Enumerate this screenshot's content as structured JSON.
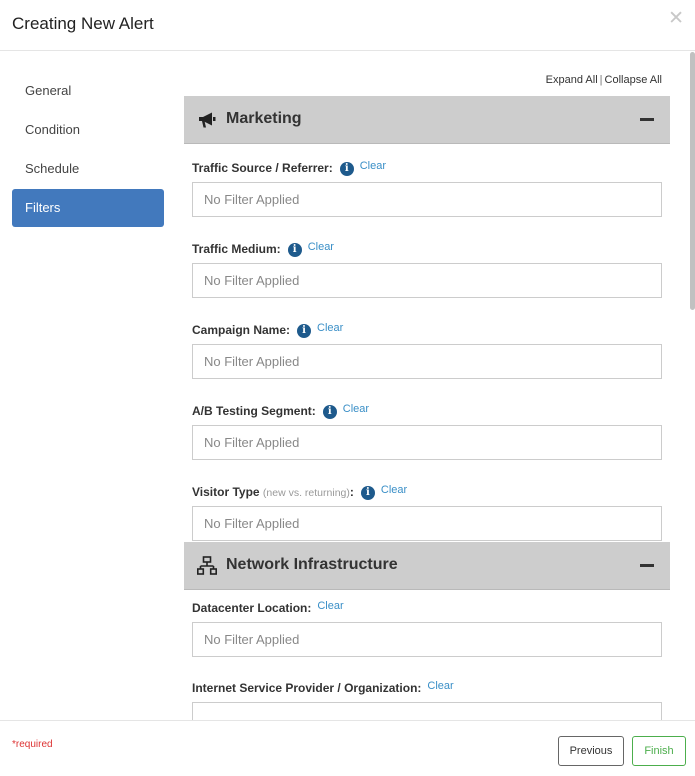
{
  "header": {
    "title": "Creating New Alert",
    "close_glyph": "✕"
  },
  "sidebar": {
    "items": [
      {
        "label": "General",
        "active": false
      },
      {
        "label": "Condition",
        "active": false
      },
      {
        "label": "Schedule",
        "active": false
      },
      {
        "label": "Filters",
        "active": true
      }
    ]
  },
  "toolbar": {
    "expand_all": "Expand All",
    "separator": "|",
    "collapse_all": "Collapse All"
  },
  "sections": {
    "marketing": {
      "title": "Marketing",
      "icon": "megaphone-icon",
      "fields": [
        {
          "label": "Traffic Source / Referrer:",
          "has_info": true,
          "clear": "Clear",
          "value": "No Filter Applied"
        },
        {
          "label": "Traffic Medium:",
          "has_info": true,
          "clear": "Clear",
          "value": "No Filter Applied"
        },
        {
          "label": "Campaign Name:",
          "has_info": true,
          "clear": "Clear",
          "value": "No Filter Applied"
        },
        {
          "label": "A/B Testing Segment:",
          "has_info": true,
          "clear": "Clear",
          "value": "No Filter Applied"
        },
        {
          "label": "Visitor Type",
          "hint": "(new vs. returning)",
          "suffix": ":",
          "has_info": true,
          "clear": "Clear",
          "value": "No Filter Applied"
        }
      ]
    },
    "network": {
      "title": "Network Infrastructure",
      "icon": "network-icon",
      "fields": [
        {
          "label": "Datacenter Location:",
          "has_info": false,
          "clear": "Clear",
          "value": "No Filter Applied"
        },
        {
          "label": "Internet Service Provider / Organization:",
          "has_info": false,
          "clear": "Clear",
          "value": ""
        }
      ]
    }
  },
  "info_glyph": "i",
  "footer": {
    "required_note": "*required",
    "previous_label": "Previous",
    "finish_label": "Finish"
  },
  "colors": {
    "accent": "#4279bd",
    "info": "#1e5a8c",
    "link": "#3a8fc7",
    "finish": "#4cae4c",
    "required": "#dd3333",
    "section_bg": "#cdcdcd"
  }
}
